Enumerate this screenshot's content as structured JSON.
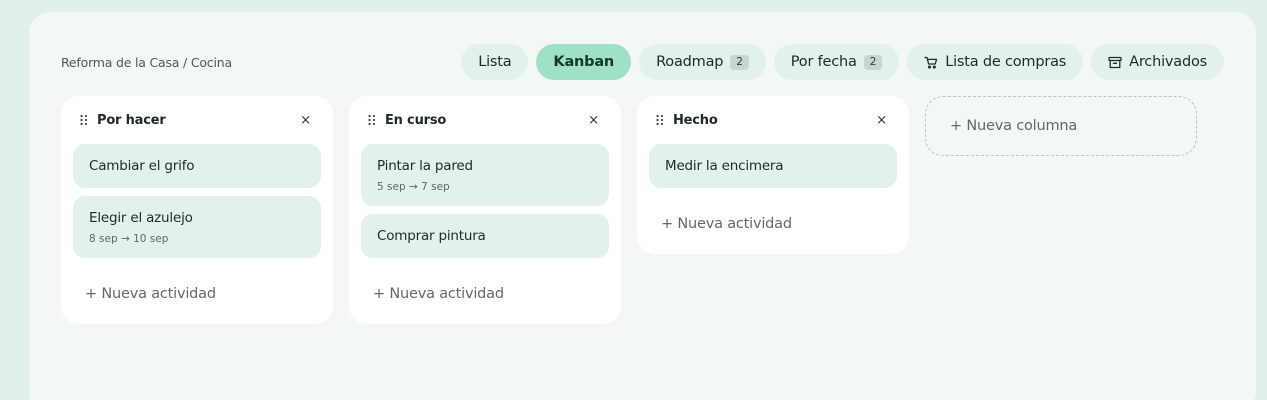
{
  "breadcrumb": "Reforma de la Casa / Cocina",
  "tabs": [
    {
      "label": "Lista",
      "badge": null,
      "icon": null,
      "active": false
    },
    {
      "label": "Kanban",
      "badge": null,
      "icon": null,
      "active": true
    },
    {
      "label": "Roadmap",
      "badge": "2",
      "icon": null,
      "active": false
    },
    {
      "label": "Por fecha",
      "badge": "2",
      "icon": null,
      "active": false
    },
    {
      "label": "Lista de compras",
      "badge": null,
      "icon": "cart-icon",
      "active": false
    },
    {
      "label": "Archivados",
      "badge": null,
      "icon": "archive-icon",
      "active": false
    }
  ],
  "columns": [
    {
      "title": "Por hacer",
      "cards": [
        {
          "title": "Cambiar el grifo",
          "date": null
        },
        {
          "title": "Elegir el azulejo",
          "date": "8 sep → 10 sep"
        }
      ]
    },
    {
      "title": "En curso",
      "cards": [
        {
          "title": "Pintar la pared",
          "date": "5 sep → 7 sep"
        },
        {
          "title": "Comprar pintura",
          "date": null
        }
      ]
    },
    {
      "title": "Hecho",
      "cards": [
        {
          "title": "Medir la encimera",
          "date": null
        }
      ]
    }
  ],
  "labels": {
    "new_activity": "+ Nueva actividad",
    "new_column": "+ Nueva columna",
    "close": "×"
  },
  "colors": {
    "background": "#e2f0ea",
    "panel": "#f3f8f5",
    "active_tab": "#9fe1c5",
    "card": "#e2f2eb"
  }
}
